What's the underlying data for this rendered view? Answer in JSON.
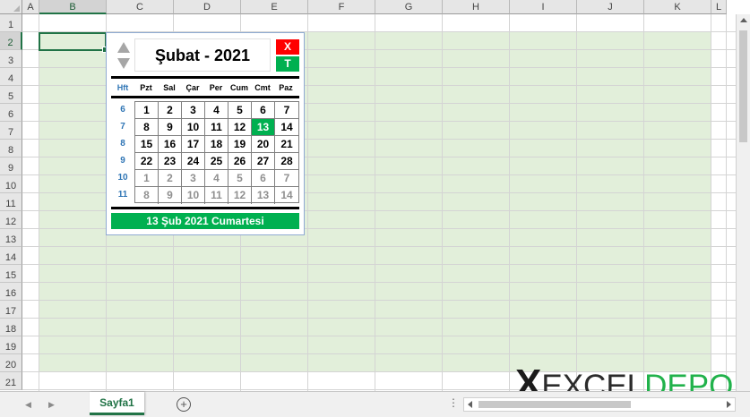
{
  "sheet": {
    "columns": [
      "A",
      "B",
      "C",
      "D",
      "E",
      "F",
      "G",
      "H",
      "I",
      "J",
      "K",
      "L"
    ],
    "selected_column": "B",
    "rows": [
      "1",
      "2",
      "3",
      "4",
      "5",
      "6",
      "7",
      "8",
      "9",
      "10",
      "11",
      "12",
      "13",
      "14",
      "15",
      "16",
      "17",
      "18",
      "19",
      "20",
      "21"
    ],
    "selected_row": "2"
  },
  "tabs": {
    "active": "Sayfa1",
    "add_label": "+"
  },
  "watermark": {
    "x": "X",
    "excel": "EXCEL",
    "depo": "DEPO"
  },
  "calendar": {
    "month_title": "Şubat - 2021",
    "close_label": "X",
    "today_label": "T",
    "week_header": "Hft",
    "weekdays": [
      "Pzt",
      "Sal",
      "Çar",
      "Per",
      "Cum",
      "Cmt",
      "Paz"
    ],
    "weeks": [
      "6",
      "7",
      "8",
      "9",
      "10",
      "11"
    ],
    "days": [
      [
        "1",
        "2",
        "3",
        "4",
        "5",
        "6",
        "7"
      ],
      [
        "8",
        "9",
        "10",
        "11",
        "12",
        "13",
        "14"
      ],
      [
        "15",
        "16",
        "17",
        "18",
        "19",
        "20",
        "21"
      ],
      [
        "22",
        "23",
        "24",
        "25",
        "26",
        "27",
        "28"
      ],
      [
        "1",
        "2",
        "3",
        "4",
        "5",
        "6",
        "7"
      ],
      [
        "8",
        "9",
        "10",
        "11",
        "12",
        "13",
        "14"
      ]
    ],
    "today_day": "13",
    "status_text": "13 Şub 2021   Cumartesi",
    "colors": {
      "accent_green": "#00b050",
      "close_red": "#ff0000",
      "week_blue": "#2f75b5"
    }
  }
}
